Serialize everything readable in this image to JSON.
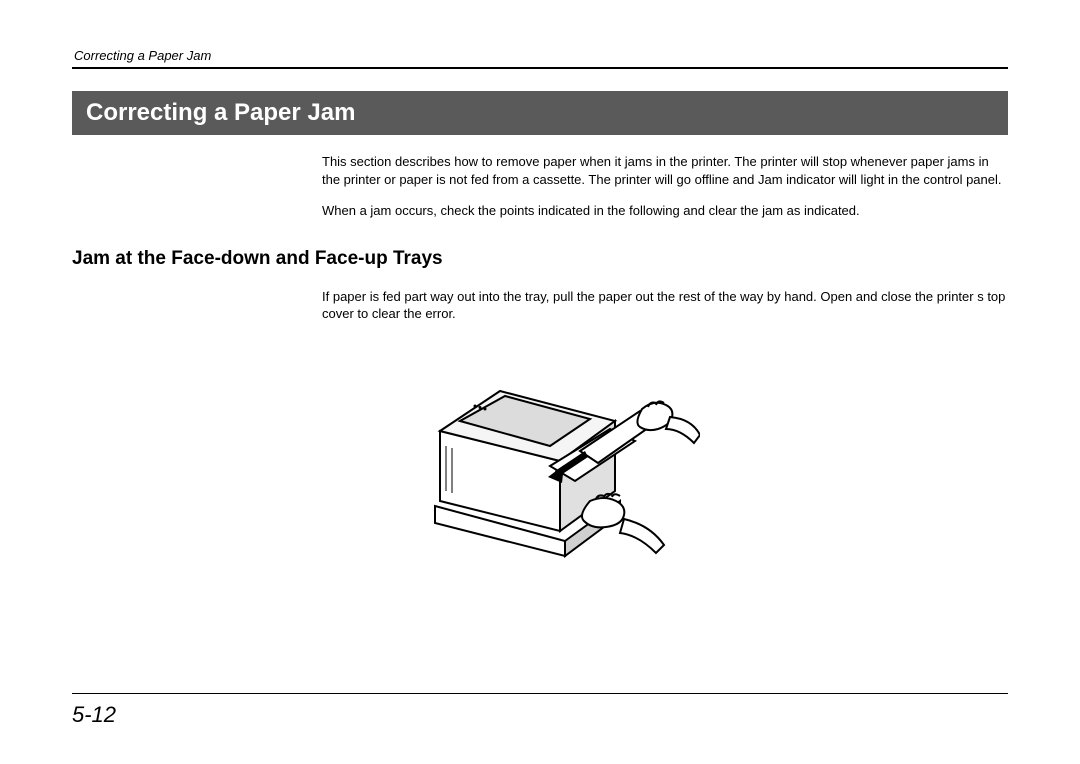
{
  "running_header": "Correcting a Paper Jam",
  "section_title": "Correcting a Paper Jam",
  "intro_para_1": "This section describes how to remove paper when it jams in the printer.  The printer will stop whenever paper jams in the printer or paper is not fed from a cassette.  The printer will go offline and Jam indicator will light in the control panel.",
  "intro_para_2": "When a jam occurs, check the points indicated in the following and clear the jam as indicated.",
  "subheading": "Jam at the Face-down and Face-up Trays",
  "sub_para_1": "If paper is fed part way out into the tray, pull the paper out the rest of the way by hand. Open and close the printer s top cover to clear the error.",
  "page_number": "5-12"
}
